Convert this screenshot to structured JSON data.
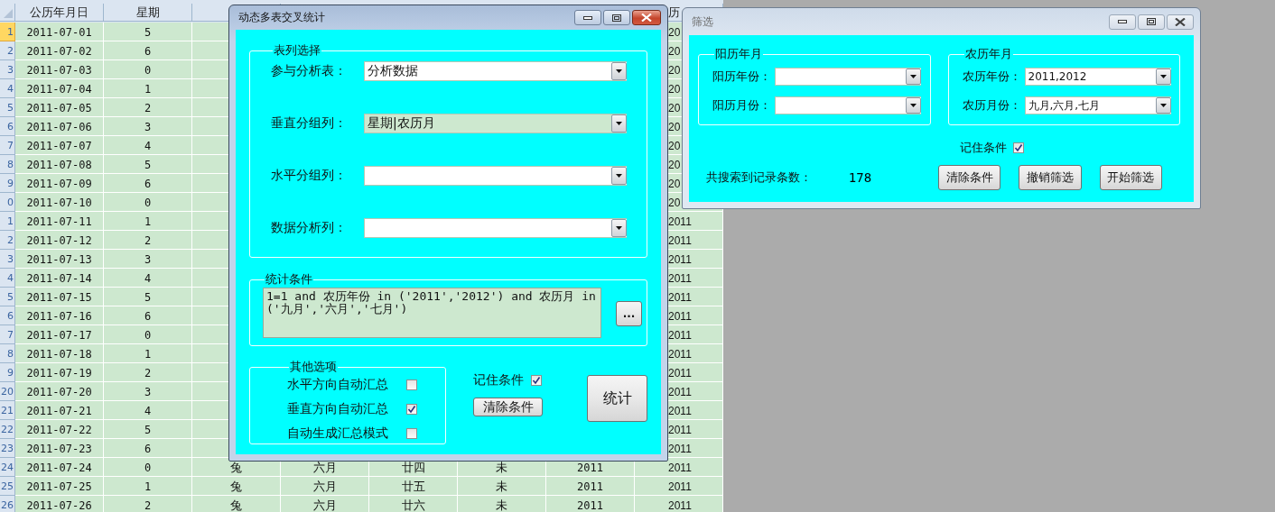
{
  "spreadsheet": {
    "headers": {
      "date": "公历年月日",
      "weekday": "星期",
      "column_8": "历"
    },
    "rows": [
      {
        "number": "1",
        "selected": true,
        "date": "2011-07-01",
        "weekday": "5",
        "column_8": "20"
      },
      {
        "number": "2",
        "selected": false,
        "date": "2011-07-02",
        "weekday": "6",
        "column_8": "20"
      },
      {
        "number": "3",
        "selected": false,
        "date": "2011-07-03",
        "weekday": "0",
        "column_8": "20"
      },
      {
        "number": "4",
        "selected": false,
        "date": "2011-07-04",
        "weekday": "1",
        "column_8": "20"
      },
      {
        "number": "5",
        "selected": false,
        "date": "2011-07-05",
        "weekday": "2",
        "column_8": "20"
      },
      {
        "number": "6",
        "selected": false,
        "date": "2011-07-06",
        "weekday": "3",
        "column_8": "20"
      },
      {
        "number": "7",
        "selected": false,
        "date": "2011-07-07",
        "weekday": "4",
        "column_8": "20"
      },
      {
        "number": "8",
        "selected": false,
        "date": "2011-07-08",
        "weekday": "5",
        "column_8": "20"
      },
      {
        "number": "9",
        "selected": false,
        "date": "2011-07-09",
        "weekday": "6",
        "column_8": "20"
      },
      {
        "number": "0",
        "selected": false,
        "date": "2011-07-10",
        "weekday": "0",
        "column_8": "20"
      },
      {
        "number": "1",
        "selected": false,
        "date": "2011-07-11",
        "weekday": "1",
        "column_8": "2011"
      },
      {
        "number": "2",
        "selected": false,
        "date": "2011-07-12",
        "weekday": "2",
        "column_8": "2011"
      },
      {
        "number": "3",
        "selected": false,
        "date": "2011-07-13",
        "weekday": "3",
        "column_8": "2011"
      },
      {
        "number": "4",
        "selected": false,
        "date": "2011-07-14",
        "weekday": "4",
        "column_8": "2011"
      },
      {
        "number": "5",
        "selected": false,
        "date": "2011-07-15",
        "weekday": "5",
        "column_8": "2011"
      },
      {
        "number": "6",
        "selected": false,
        "date": "2011-07-16",
        "weekday": "6",
        "column_8": "2011"
      },
      {
        "number": "7",
        "selected": false,
        "date": "2011-07-17",
        "weekday": "0",
        "column_8": "2011"
      },
      {
        "number": "8",
        "selected": false,
        "date": "2011-07-18",
        "weekday": "1",
        "column_8": "2011"
      },
      {
        "number": "9",
        "selected": false,
        "date": "2011-07-19",
        "weekday": "2",
        "column_8": "2011"
      },
      {
        "number": "20",
        "selected": false,
        "date": "2011-07-20",
        "weekday": "3",
        "column_8": "2011"
      },
      {
        "number": "21",
        "selected": false,
        "date": "2011-07-21",
        "weekday": "4",
        "column_8": "2011"
      },
      {
        "number": "22",
        "selected": false,
        "date": "2011-07-22",
        "weekday": "5",
        "column_8": "2011"
      },
      {
        "number": "23",
        "selected": false,
        "date": "2011-07-23",
        "weekday": "6",
        "column_8": "2011"
      },
      {
        "number": "24",
        "selected": false,
        "date": "2011-07-24",
        "weekday": "0",
        "column_3": "兔",
        "column_4": "六月",
        "column_5": "廿四",
        "column_6": "未",
        "column_7": "2011",
        "column_8": "2011"
      },
      {
        "number": "25",
        "selected": false,
        "date": "2011-07-25",
        "weekday": "1",
        "column_3": "兔",
        "column_4": "六月",
        "column_5": "廿五",
        "column_6": "未",
        "column_7": "2011",
        "column_8": "2011"
      },
      {
        "number": "26",
        "selected": false,
        "date": "2011-07-26",
        "weekday": "2",
        "column_3": "兔",
        "column_4": "六月",
        "column_5": "廿六",
        "column_6": "未",
        "column_7": "2011",
        "column_8": "2011"
      }
    ]
  },
  "analysis_dialog": {
    "title": "动态多表交叉统计",
    "active": true,
    "table_group": {
      "label": "表列选择",
      "fields": [
        {
          "label": "参与分析表：",
          "value": "分析数据",
          "focused": false
        },
        {
          "label": "垂直分组列：",
          "value": "星期|农历月",
          "focused": true
        },
        {
          "label": "水平分组列：",
          "focused": false
        },
        {
          "label": "数据分析列：",
          "focused": false
        }
      ]
    },
    "condition_group": {
      "label": "统计条件",
      "text": "1=1 and 农历年份 in ('2011','2012') and 农历月 in ('九月','六月','七月')",
      "browse_button": "..."
    },
    "options_group": {
      "label": "其他选项",
      "options": [
        {
          "label": "水平方向自动汇总",
          "checked": false
        },
        {
          "label": "垂直方向自动汇总",
          "checked": true
        },
        {
          "label": "自动生成汇总模式",
          "checked": false
        }
      ]
    },
    "remember": {
      "label": "记住条件",
      "checked": true
    },
    "clear_button": "清除条件",
    "run_button": "统计"
  },
  "filter_dialog": {
    "title": "筛选",
    "active": false,
    "groups": [
      {
        "label": "阳历年月",
        "fields": [
          {
            "label": "阳历年份：",
            "focused": false
          },
          {
            "label": "阳历月份：",
            "focused": false
          }
        ]
      },
      {
        "label": "农历年月",
        "fields": [
          {
            "label": "农历年份：",
            "value": "2011,2012",
            "focused": false
          },
          {
            "label": "农历月份：",
            "value": "九月,六月,七月",
            "focused": false
          }
        ]
      }
    ],
    "remember": {
      "label": "记住条件",
      "checked": true
    },
    "count_label": "共搜索到记录条数：",
    "count": "178",
    "buttons": [
      "清除条件",
      "撤销筛选",
      "开始筛选"
    ]
  }
}
